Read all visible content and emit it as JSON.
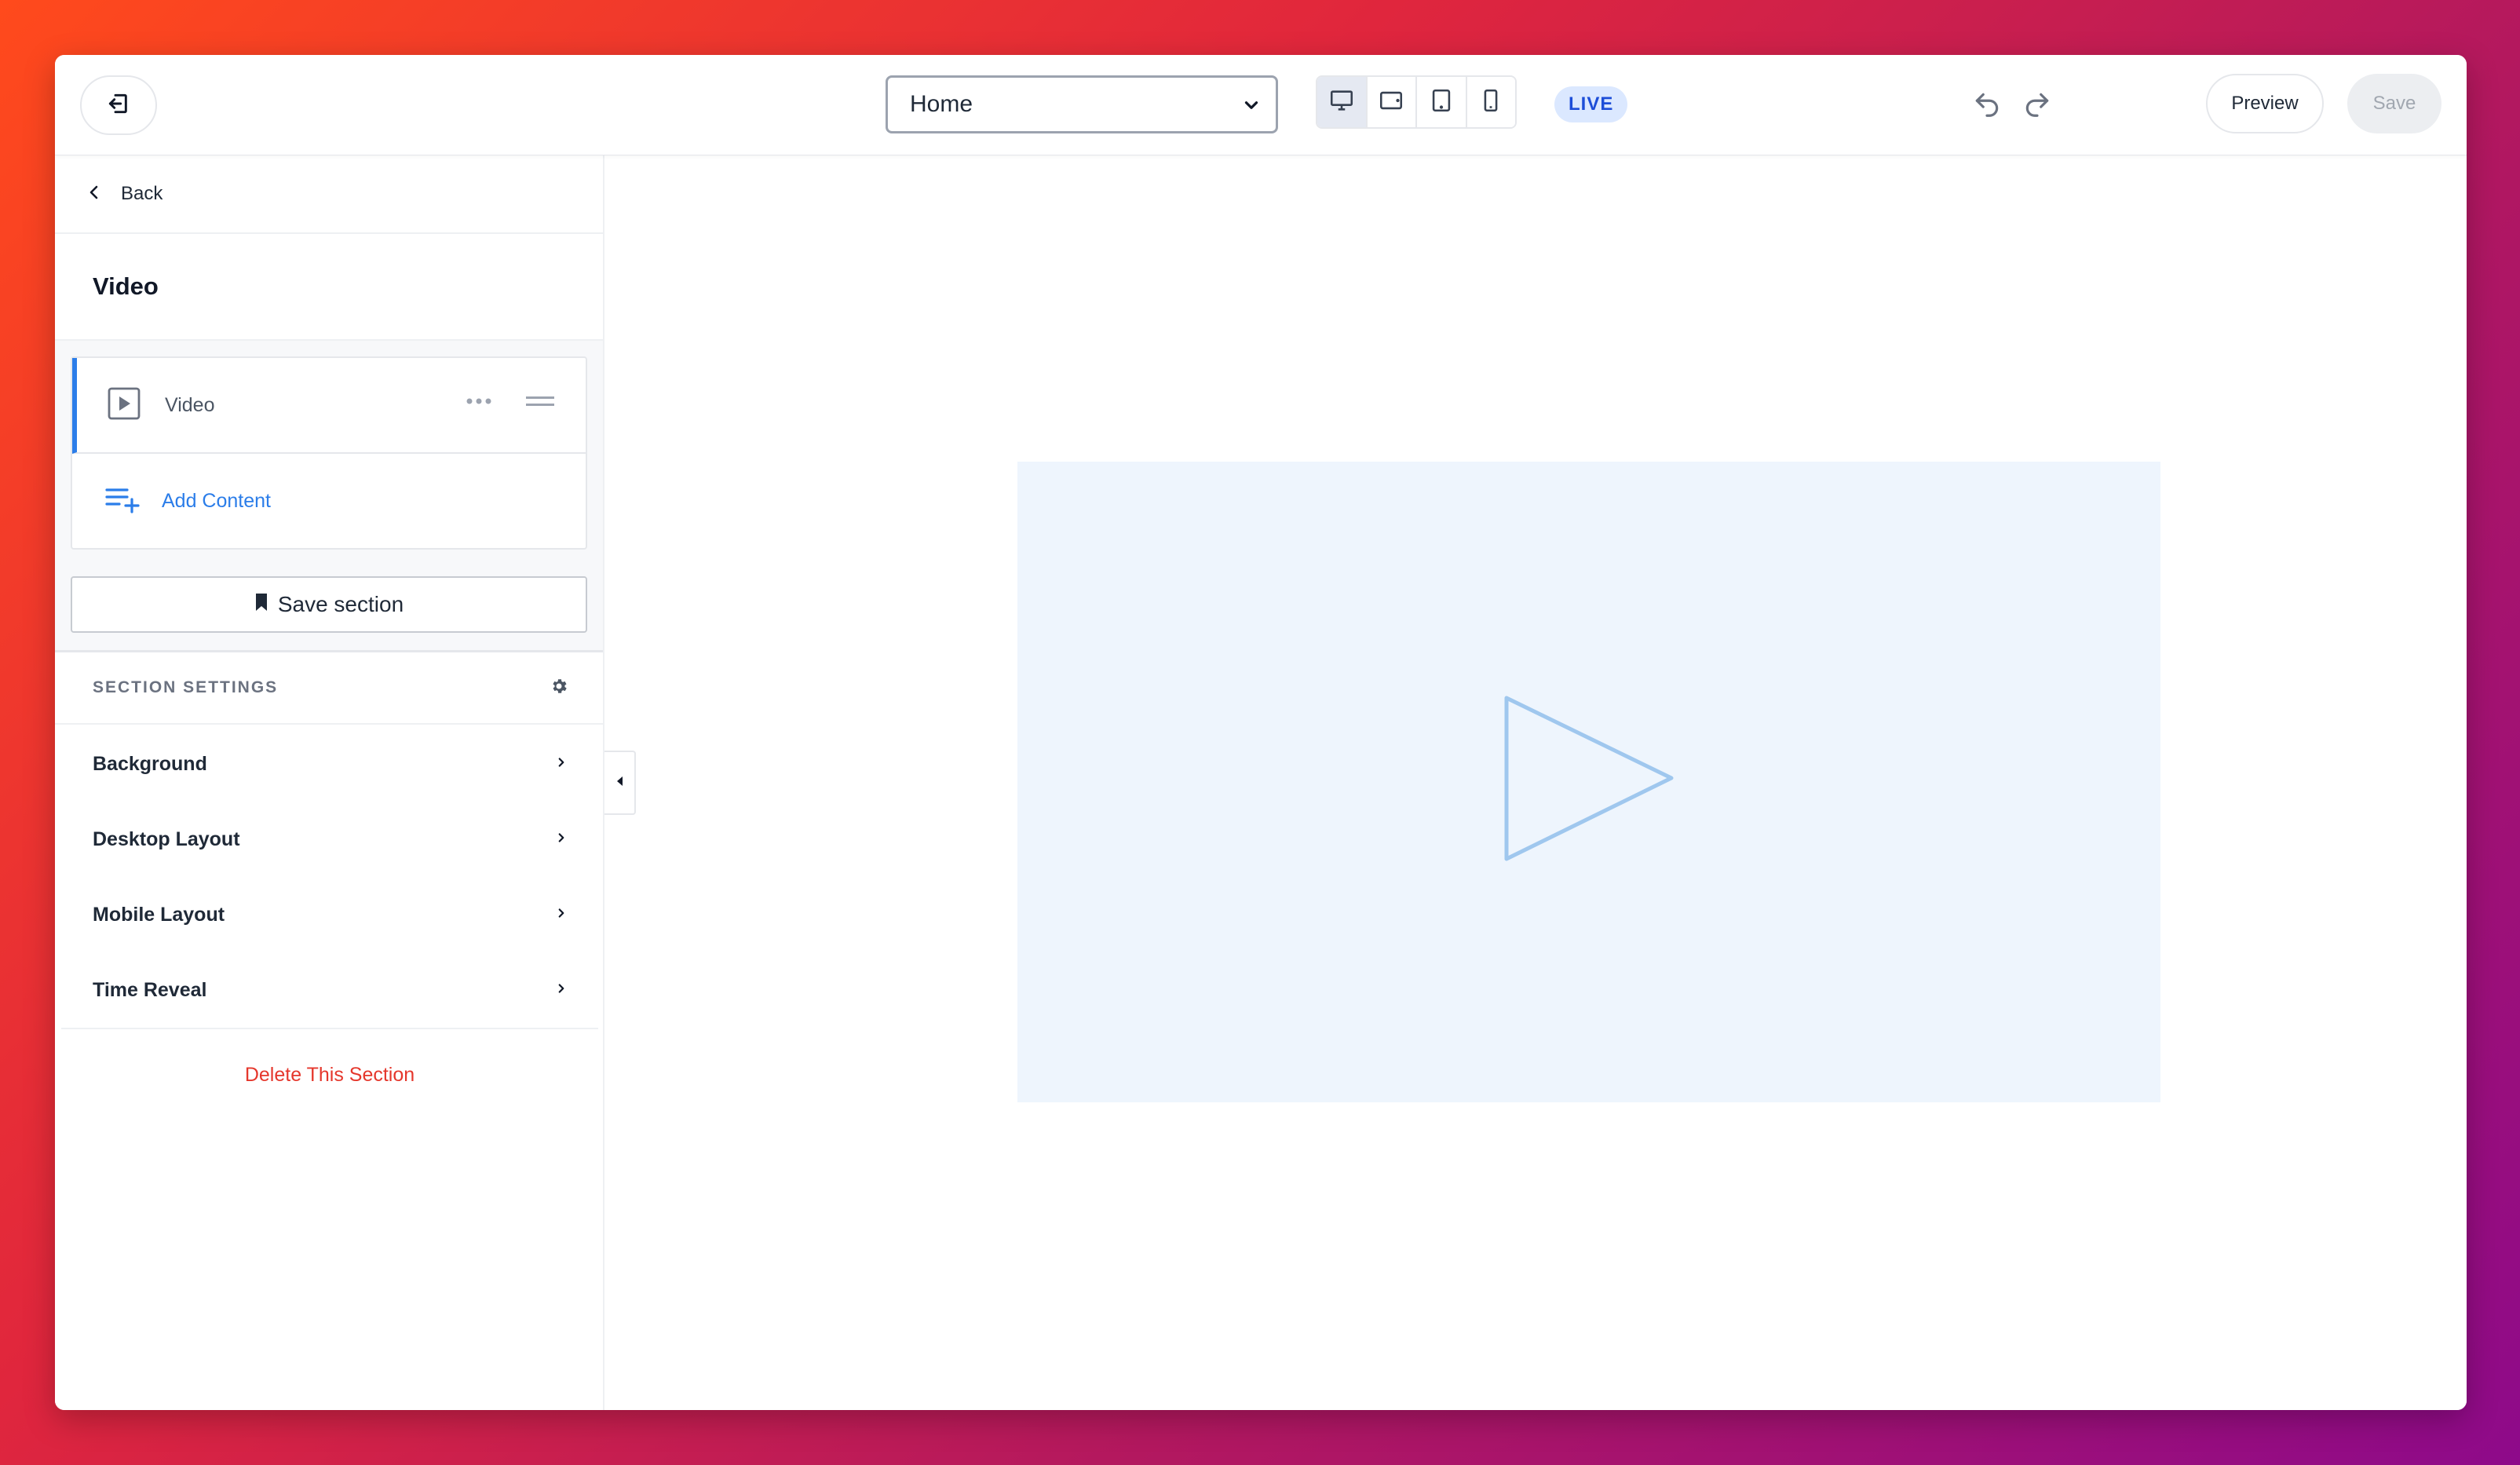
{
  "topbar": {
    "page_selector": {
      "value": "Home"
    },
    "devices": [
      "desktop",
      "tablet-landscape",
      "tablet-portrait",
      "mobile"
    ],
    "active_device": "desktop",
    "live_badge": "LIVE",
    "preview_label": "Preview",
    "save_label": "Save"
  },
  "sidebar": {
    "back_label": "Back",
    "section_title": "Video",
    "content_items": [
      {
        "label": "Video",
        "icon": "video-play-icon",
        "selected": true
      }
    ],
    "add_content_label": "Add Content",
    "save_section_label": "Save section",
    "settings_header": "SECTION SETTINGS",
    "settings": [
      {
        "label": "Background"
      },
      {
        "label": "Desktop Layout"
      },
      {
        "label": "Mobile Layout"
      },
      {
        "label": "Time Reveal"
      }
    ],
    "delete_label": "Delete This Section"
  },
  "canvas": {
    "placeholder_icon": "play-triangle-icon"
  },
  "colors": {
    "accent": "#2b7de9",
    "danger": "#e5372c",
    "live_bg": "#dbe8ff",
    "live_text": "#1d4ed8",
    "video_placeholder_bg": "#eef5fd",
    "play_outline": "#9fc7ee"
  }
}
